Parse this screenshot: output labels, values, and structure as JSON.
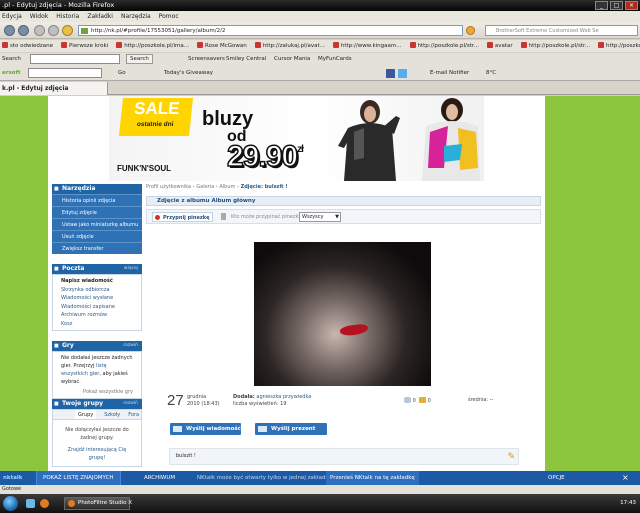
{
  "window": {
    "title": ".pl - Edytuj zdjęcia - Mozilla Firefox",
    "controls": [
      "_",
      "□",
      "×"
    ]
  },
  "menu": [
    "Edycja",
    "Widok",
    "Historia",
    "Zakładki",
    "Narzędzia",
    "Pomoc"
  ],
  "navigation": {
    "url": "http://nk.pl/#profile/17553051/gallery/album/2/2",
    "search_placeholder": "BrotherSoft Extreme Customized Web Se"
  },
  "bookmarks": [
    "sto odwiedzane",
    "Pierwsze kroki",
    "http://poszkole.pl/ima...",
    "Rose McGowan",
    "http://zalukaj.pl/avat...",
    "http://www.kingaam...",
    "http://poszkole.pl/str...",
    "avatar",
    "http://poszkole.pl/str...",
    "http://poszkole.pl/str..."
  ],
  "toolbar1": {
    "label": "Search",
    "search_button": "Search",
    "items": [
      "Screensavers",
      "Smiley Central",
      "Cursor Mania",
      "MyFunCards"
    ]
  },
  "toolbar2": {
    "brand": "ersoft",
    "go": "Go",
    "todays_giveaway": "Today's Giveaway",
    "email_notifier": "E-mail Notifier",
    "temperature": "8°C"
  },
  "tab": {
    "title": "k.pl - Edytuj zdjęcia"
  },
  "banner": {
    "sale": "SALE",
    "sale_sub": "ostatnie dni",
    "product": "bluzy",
    "from": "od",
    "price": "29.90",
    "currency": "zł",
    "brand": "FUNK'N'SOUL"
  },
  "sidebar": {
    "nav_title": "Narzędzia",
    "nav_items": [
      "Historia opinii zdjęcia",
      "Edytuj zdjęcie",
      "Ustaw jako miniaturkę albumu",
      "Usuń zdjęcie",
      "Zwiększ transfer"
    ],
    "mail_title": "Poczta",
    "mail_more": "więcej",
    "mail_items": [
      "Napisz wiadomość",
      "Skrzynka odbiorcza",
      "Wiadomości wysłane",
      "Wiadomości zapisane",
      "Archiwum rozmów",
      "Kosz"
    ],
    "games_title": "Gry",
    "games_more": "rozwiń",
    "games_text": "Nie dodałaś jeszcze żadnych gier. Przejrzyj",
    "games_link": "listę wszystkich gier",
    "games_text2": ", aby jakieś wybrać.",
    "games_all": "Pokaż wszystkie gry",
    "groups_title": "Twoje grupy",
    "groups_more": "rozwiń",
    "groups_tabs": [
      "Grupy",
      "Szkoły",
      "Fora"
    ],
    "groups_text": "Nie dołączyłaś jeszcze do żadnej grupy.",
    "groups_link": "Znajdź interesującą Cię grupę!"
  },
  "breadcrumb": [
    "Profil użytkownika",
    "Galeria",
    "Album",
    "Zdjęcie: bulszit !"
  ],
  "panel": {
    "header": "Zdjęcie z albumu Album główny",
    "pin_button": "Przypnij pinezkę",
    "pin_question": "Kto może przypinać pinezki:",
    "pin_select": "Wszyscy"
  },
  "photo_meta": {
    "day": "27",
    "month": "grudnia",
    "date_rest": "2010 (18:43)",
    "added_label": "Dodała:",
    "added_by": "agnieszka przywiedka",
    "views_label": "liczba wyświetleń:",
    "views": "19",
    "comments": "0",
    "likes": "0",
    "rating_label": "średnia:",
    "rating": "--"
  },
  "actions": {
    "send_message": "Wyślij wiadomość",
    "send_gift": "Wyślij prezent"
  },
  "comment": {
    "text": "bulszit !"
  },
  "statusbar": {
    "brand": "nktalk",
    "show_list": "POKAŻ LISTĘ ZNAJOMYCH",
    "archive": "ARCHIWUM",
    "notice": "NKtalk może być otwarty tylko w jednej zakładce",
    "move_link": "Przenieś NKtalk na tę zakładkę",
    "options": "OPCJE"
  },
  "addon_bar": {
    "text": "Gotowe"
  },
  "taskbar": {
    "task": "PhotoFiltre Studio X",
    "clock": "17:43"
  }
}
